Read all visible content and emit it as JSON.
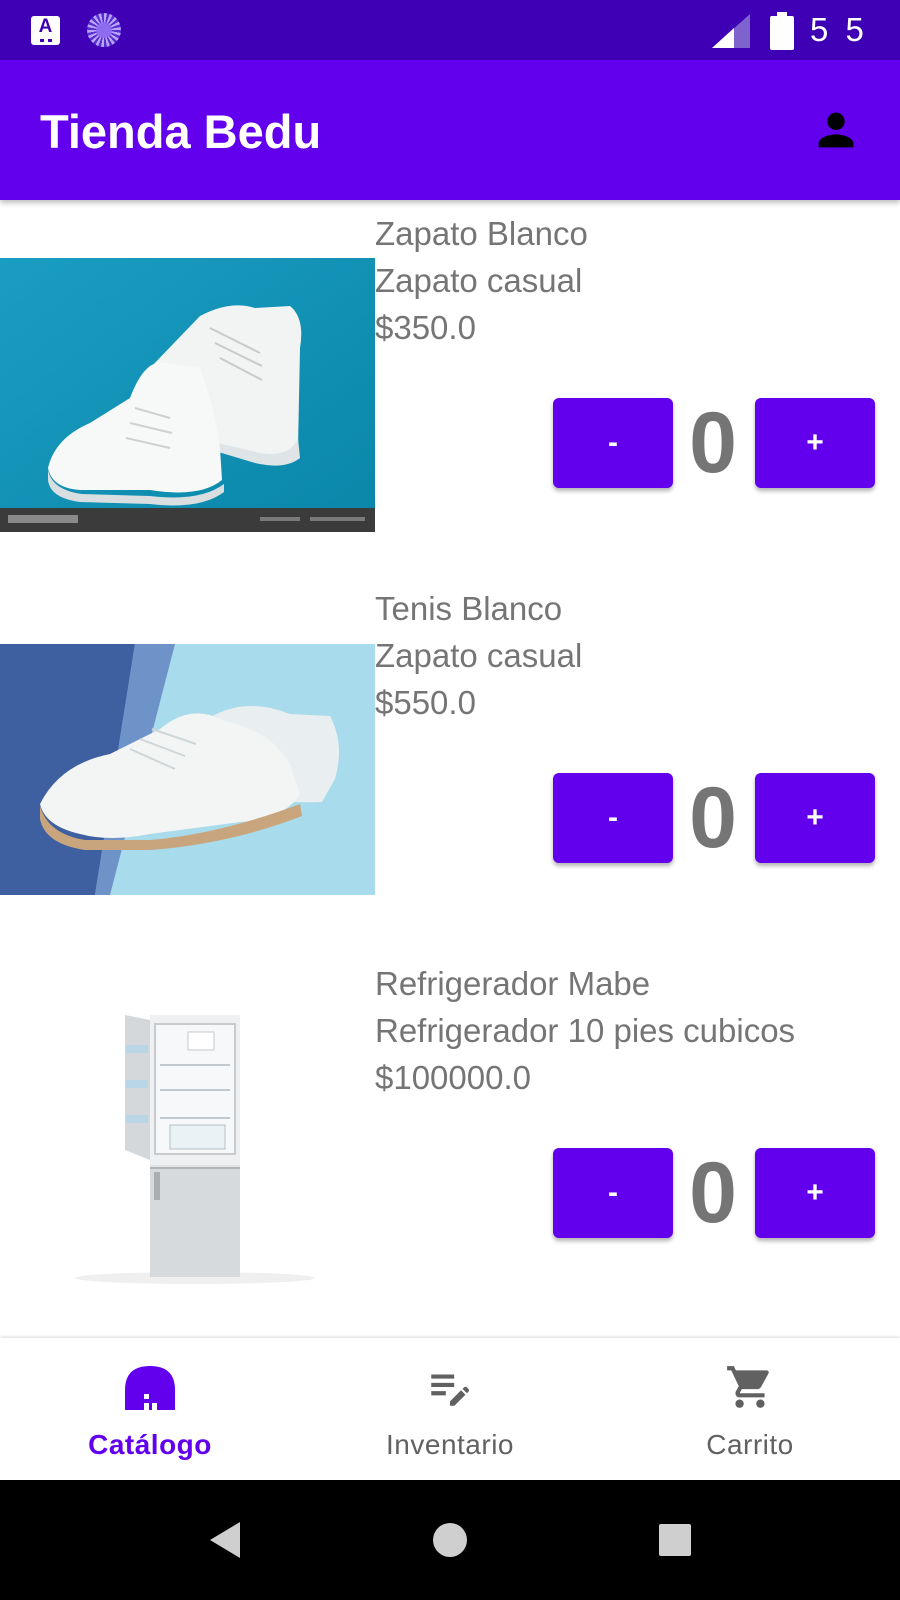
{
  "app": {
    "title": "Tienda Bedu"
  },
  "status_bar": {
    "time": "5 5"
  },
  "products": [
    {
      "name": "Zapato Blanco",
      "description": "Zapato casual",
      "price": "$350.0",
      "quantity": "0",
      "minus_label": "-",
      "plus_label": "+"
    },
    {
      "name": "Tenis Blanco",
      "description": "Zapato casual",
      "price": "$550.0",
      "quantity": "0",
      "minus_label": "-",
      "plus_label": "+"
    },
    {
      "name": "Refrigerador Mabe",
      "description": "Refrigerador 10 pies cubicos",
      "price": "$100000.0",
      "quantity": "0",
      "minus_label": "-",
      "plus_label": "+"
    }
  ],
  "bottom_nav": {
    "items": [
      {
        "label": "Catálogo",
        "icon": "store-icon",
        "active": true
      },
      {
        "label": "Inventario",
        "icon": "edit-list-icon",
        "active": false
      },
      {
        "label": "Carrito",
        "icon": "cart-icon",
        "active": false
      }
    ]
  },
  "colors": {
    "primary": "#6200ee",
    "status_bar": "#3f00b5",
    "text_gray": "#757575"
  }
}
